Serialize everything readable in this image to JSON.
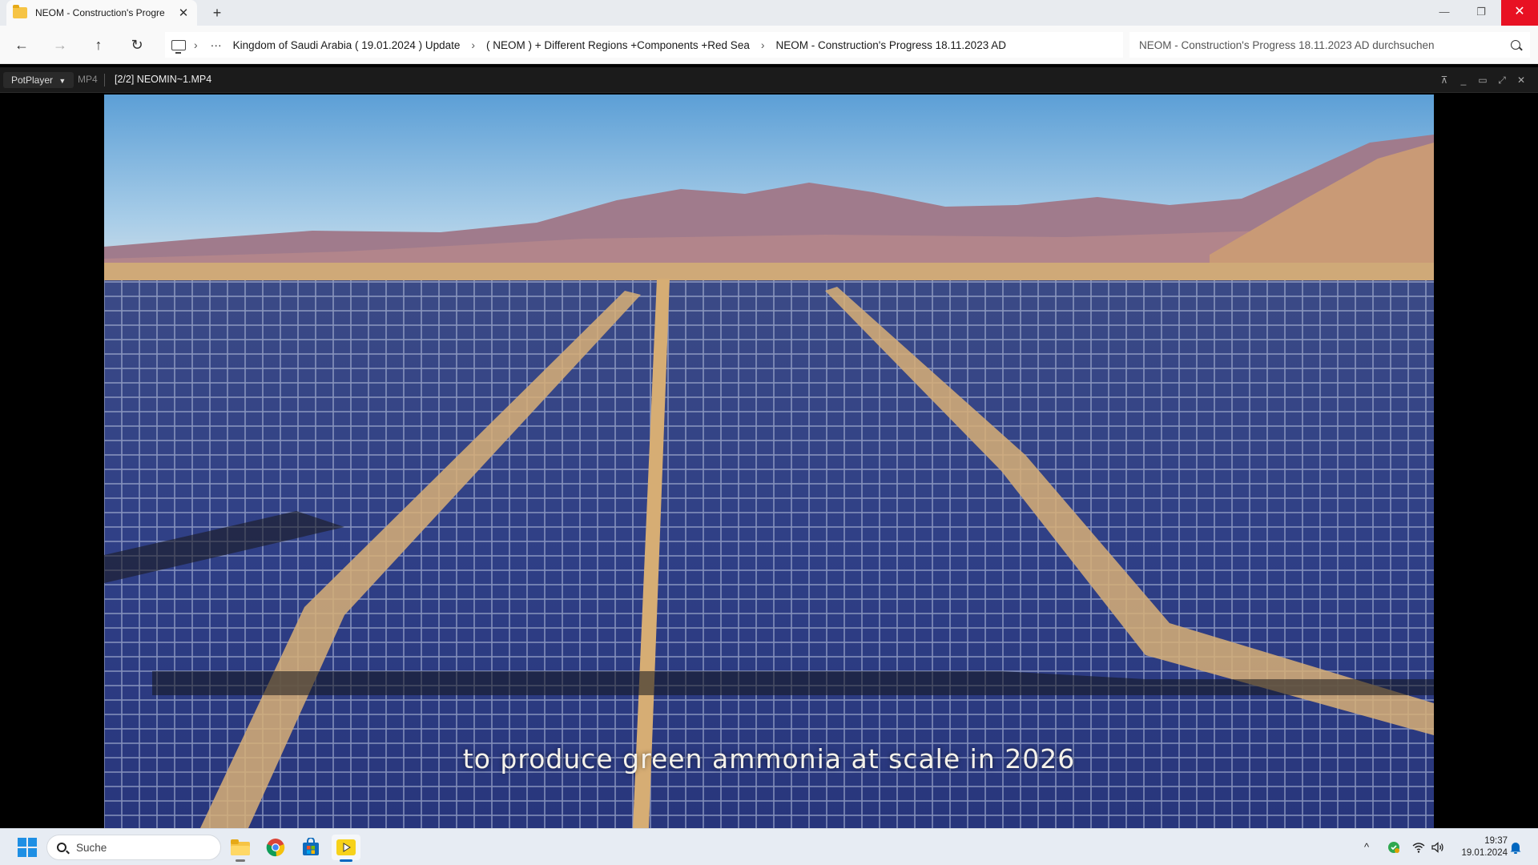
{
  "explorer": {
    "tab_title": "NEOM - Construction's Progre",
    "tab_close": "✕",
    "new_tab": "+",
    "window_controls": {
      "minimize": "—",
      "maximize": "❐",
      "close": "✕"
    },
    "nav": {
      "back": "←",
      "forward": "→",
      "up": "↑",
      "refresh": "↻"
    },
    "breadcrumb": {
      "overflow": "···",
      "items": [
        "Kingdom of Saudi Arabia ( 19.01.2024 ) Update",
        "( NEOM ) + Different Regions +Components +Red Sea",
        "NEOM - Construction's Progress 18.11.2023 AD"
      ],
      "separator": "›"
    },
    "search_placeholder": "NEOM - Construction's Progress 18.11.2023 AD durchsuchen"
  },
  "player": {
    "brand": "PotPlayer",
    "format": "MP4",
    "file": "[2/2] NEOMIN~1.MP4",
    "controls": {
      "pin": "⊼",
      "minimize": "_",
      "maximize": "▭",
      "fullscreen": "⤢",
      "close": "✕"
    },
    "subtitle": "to produce green ammonia at scale in 2026"
  },
  "taskbar": {
    "search_placeholder": "Suche",
    "apps": [
      "file-explorer",
      "chrome",
      "microsoft-store",
      "potplayer"
    ],
    "tray": {
      "chevron": "^",
      "wifi": "wifi-icon",
      "volume": "volume-icon"
    },
    "time": "19:37",
    "date": "19.01.2024"
  },
  "colors": {
    "accent": "#0067c0",
    "close_red": "#e81123",
    "folder_yellow": "#f6c445",
    "potplayer_yellow": "#f7d21a"
  }
}
